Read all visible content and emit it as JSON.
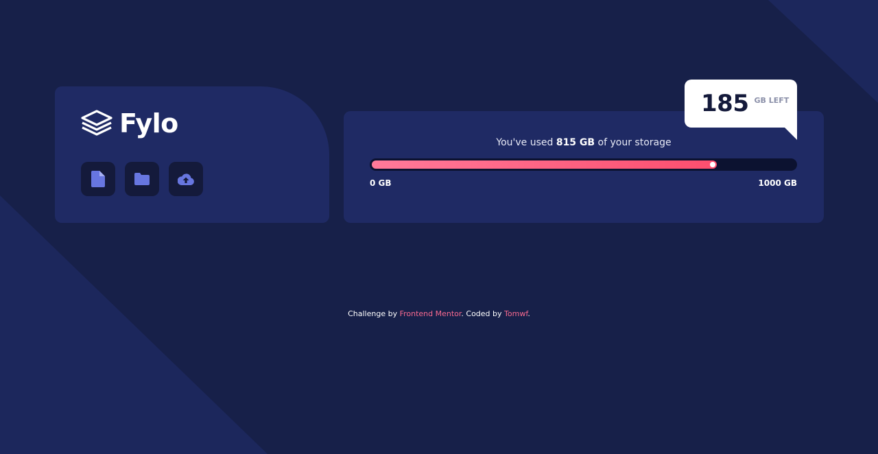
{
  "brand": {
    "name": "Fylo",
    "logo_icon": "layers-icon"
  },
  "actions": [
    {
      "icon": "document-icon"
    },
    {
      "icon": "folder-icon"
    },
    {
      "icon": "cloud-upload-icon"
    }
  ],
  "usage": {
    "prefix": "You've used ",
    "used_label": "815 GB",
    "suffix": " of your storage",
    "used_gb": 815,
    "total_gb": 1000,
    "min_label": "0 GB",
    "max_label": "1000 GB"
  },
  "callout": {
    "remaining": "185",
    "unit": "GB LEFT"
  },
  "attribution": {
    "prefix": "Challenge by ",
    "challenge_link": "Frontend Mentor",
    "middle": ". Coded by ",
    "author_link": "Tomwf",
    "suffix": "."
  },
  "colors": {
    "background": "#172049",
    "card": "#1f2a64",
    "button": "#141a3b",
    "icon_accent": "#6776e0",
    "progress_start": "#ff7a9a",
    "progress_end": "#fe4e6e",
    "link": "#fa6a90"
  }
}
